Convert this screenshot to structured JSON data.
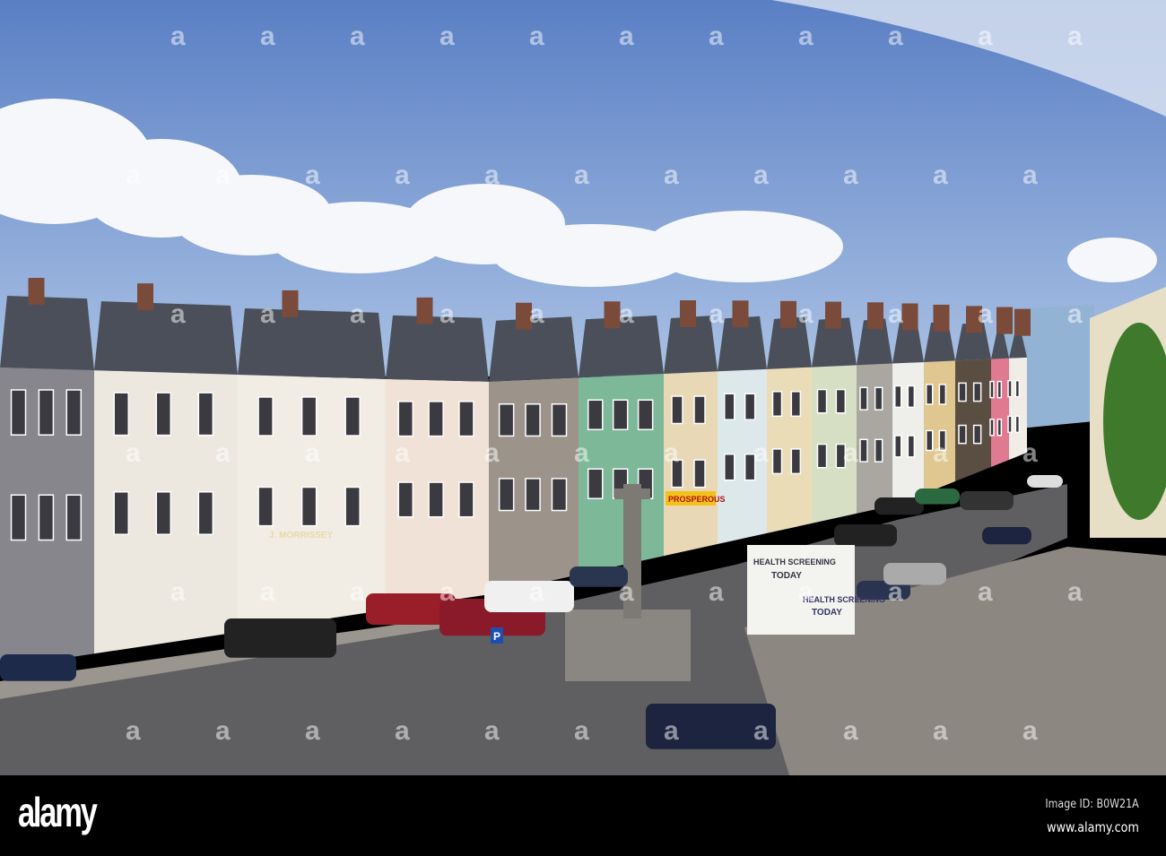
{
  "photo": {
    "signs": {
      "pub": "J. MORRISSEY",
      "shop": "PROSPEROUS",
      "van_top_line1": "HEALTH SCREENING",
      "van_top_line2": "TODAY",
      "van_side_line1": "HEALTH SCREENING",
      "van_side_line2": "TODAY",
      "parking": "P"
    },
    "watermark": "a"
  },
  "footer": {
    "logo": "alamy",
    "image_id": "Image ID: B0W21A",
    "website": "www.alamy.com"
  }
}
